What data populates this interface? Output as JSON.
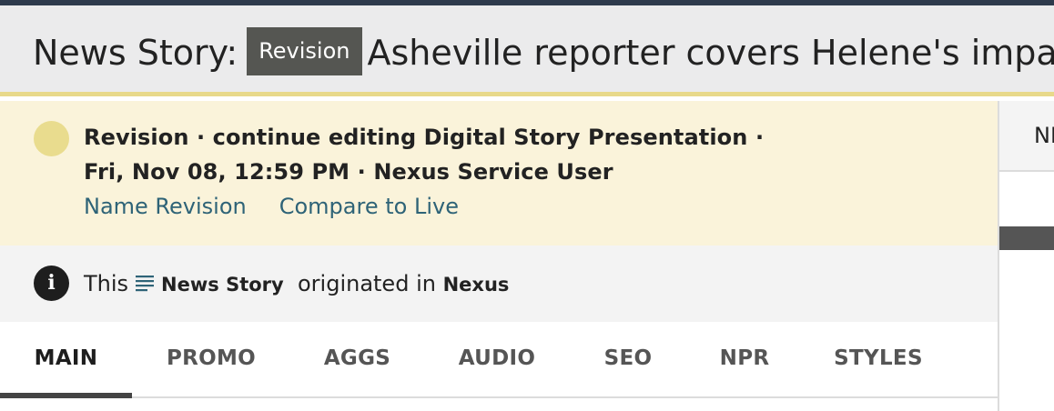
{
  "header": {
    "prefix": "News Story:",
    "badge": "Revision",
    "title": "Asheville reporter covers Helene's impact in"
  },
  "revision": {
    "label": "Revision",
    "action": "continue editing Digital Story Presentation",
    "separator": "·",
    "datetime": "Fri, Nov 08, 12:59 PM",
    "user": "Nexus Service User",
    "links": {
      "name_revision": "Name Revision",
      "compare_to_live": "Compare to Live"
    }
  },
  "origin": {
    "prefix": "This",
    "type": "News Story",
    "middle": "originated in",
    "source": "Nexus"
  },
  "tabs": [
    {
      "label": "MAIN",
      "active": true
    },
    {
      "label": "PROMO"
    },
    {
      "label": "AGGS"
    },
    {
      "label": "AUDIO"
    },
    {
      "label": "SEO"
    },
    {
      "label": "NPR"
    },
    {
      "label": "STYLES"
    }
  ],
  "right_panel": {
    "tab_label": "NPR"
  },
  "colors": {
    "topbar": "#2e3a4c",
    "header_bg": "#ebebec",
    "revision_bg": "#faf3da",
    "accent_yellow": "#e9dc8e",
    "link": "#2e6377"
  }
}
